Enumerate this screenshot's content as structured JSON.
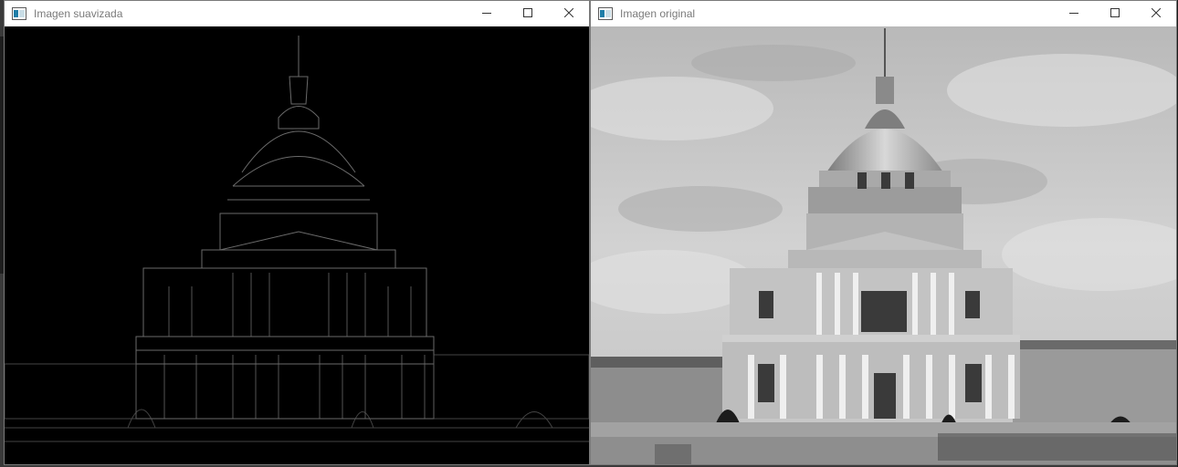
{
  "windows": {
    "left": {
      "title": "Imagen suavizada",
      "content": "edge-detected image of domed building"
    },
    "right": {
      "title": "Imagen original",
      "content": "grayscale photo of domed building under cloudy sky"
    }
  },
  "controls": {
    "minimize_icon": "minimize-icon",
    "maximize_icon": "maximize-icon",
    "close_icon": "close-icon"
  },
  "colors": {
    "titlebar_bg": "#ffffff",
    "title_text": "#7a7a7a",
    "edge_bg": "#000000",
    "edge_lines": "#8a8a8a",
    "sky": "#c9c9c9",
    "building": "#b5b5b5"
  }
}
